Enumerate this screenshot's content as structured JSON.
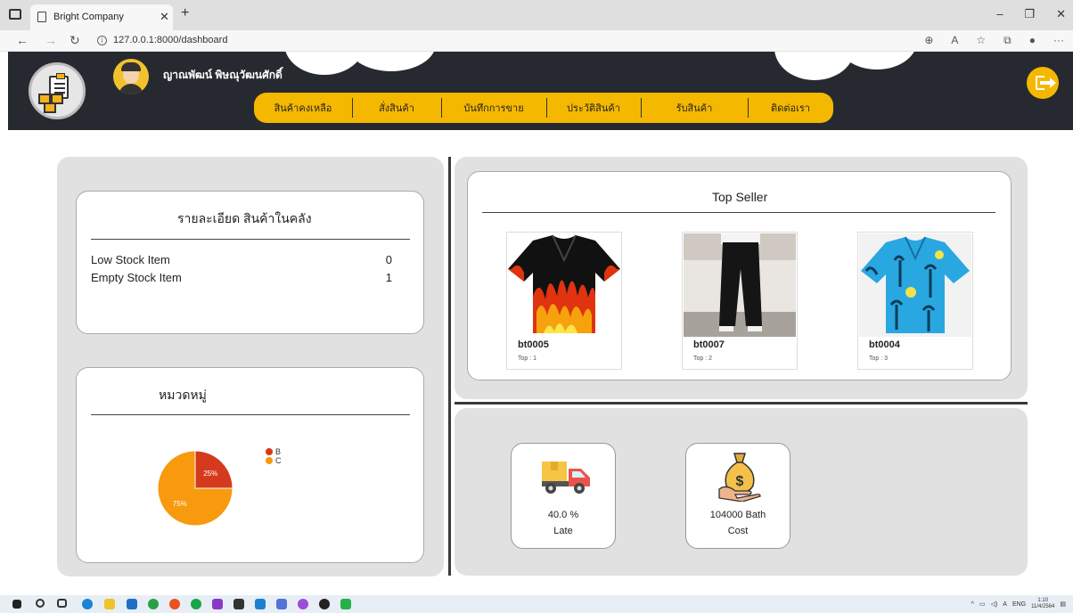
{
  "browser": {
    "tab_title": "Bright Company",
    "url": "127.0.0.1:8000/dashboard"
  },
  "header": {
    "user_name": "ญาณพัฒน์ พิษณุวัฒนศักดิ์",
    "nav": [
      {
        "label": "สินค้าคงเหลือ"
      },
      {
        "label": "สั่งสินค้า"
      },
      {
        "label": "บันทึกการขาย"
      },
      {
        "label": "ประวัติสินค้า"
      },
      {
        "label": "รับสินค้า"
      },
      {
        "label": "ติดต่อเรา"
      }
    ]
  },
  "stock_card": {
    "title": "รายละเอียด สินค้าในคลัง",
    "rows": [
      {
        "label": "Low Stock Item",
        "value": "0"
      },
      {
        "label": "Empty Stock Item",
        "value": "1"
      }
    ]
  },
  "category_card": {
    "title": "หมวดหมู่"
  },
  "chart_data": {
    "type": "pie",
    "categories": [
      "B",
      "C"
    ],
    "values": [
      25,
      75
    ],
    "labels": [
      "25%",
      "75%"
    ],
    "colors": [
      "#d53a1d",
      "#f79a0e"
    ],
    "legend": "right"
  },
  "top_seller": {
    "title": "Top Seller",
    "items": [
      {
        "code": "bt0005",
        "rank": "Top : 1"
      },
      {
        "code": "bt0007",
        "rank": "Top : 2"
      },
      {
        "code": "bt0004",
        "rank": "Top : 3"
      }
    ]
  },
  "stats": {
    "late": {
      "value": "40.0 %",
      "label": "Late",
      "icon": "delivery-truck-icon"
    },
    "cost": {
      "value": "104000 Bath",
      "label": "Cost",
      "icon": "money-bag-icon"
    }
  },
  "taskbar": {
    "lang": "ENG",
    "time": "1:10",
    "date": "11/4/2564"
  }
}
